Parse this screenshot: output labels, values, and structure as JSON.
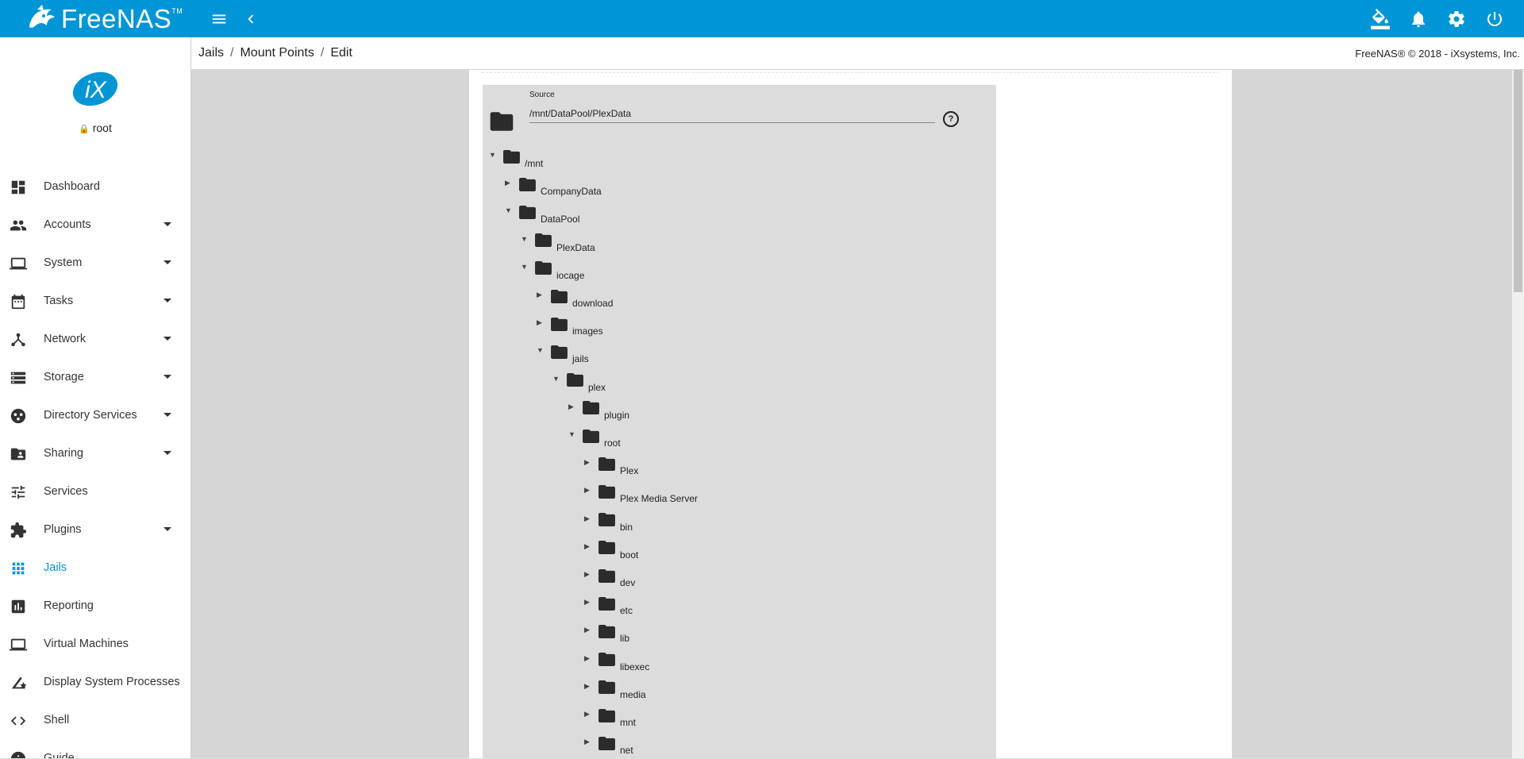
{
  "app": {
    "name": "FreeNAS",
    "trademark": "TM"
  },
  "topbar": {
    "icons": [
      "menu-icon",
      "chevron-left-icon",
      "paint-bucket-icon",
      "bell-icon",
      "gear-icon",
      "power-icon"
    ]
  },
  "user": {
    "name": "root"
  },
  "sidebar": {
    "items": [
      {
        "label": "Dashboard",
        "icon": "dashboard-icon",
        "has_children": false,
        "active": false
      },
      {
        "label": "Accounts",
        "icon": "people-icon",
        "has_children": true,
        "active": false
      },
      {
        "label": "System",
        "icon": "laptop-icon",
        "has_children": true,
        "active": false
      },
      {
        "label": "Tasks",
        "icon": "calendar-icon",
        "has_children": true,
        "active": false
      },
      {
        "label": "Network",
        "icon": "network-icon",
        "has_children": true,
        "active": false
      },
      {
        "label": "Storage",
        "icon": "storage-icon",
        "has_children": true,
        "active": false
      },
      {
        "label": "Directory Services",
        "icon": "directory-icon",
        "has_children": true,
        "active": false
      },
      {
        "label": "Sharing",
        "icon": "share-folder-icon",
        "has_children": true,
        "active": false
      },
      {
        "label": "Services",
        "icon": "tune-icon",
        "has_children": false,
        "active": false
      },
      {
        "label": "Plugins",
        "icon": "puzzle-icon",
        "has_children": true,
        "active": false
      },
      {
        "label": "Jails",
        "icon": "apps-grid-icon",
        "has_children": false,
        "active": true
      },
      {
        "label": "Reporting",
        "icon": "bar-chart-icon",
        "has_children": false,
        "active": false
      },
      {
        "label": "Virtual Machines",
        "icon": "laptop-icon",
        "has_children": false,
        "active": false
      },
      {
        "label": "Display System Processes",
        "icon": "processes-icon",
        "has_children": false,
        "active": false
      },
      {
        "label": "Shell",
        "icon": "code-icon",
        "has_children": false,
        "active": false
      },
      {
        "label": "Guide",
        "icon": "info-icon",
        "has_children": false,
        "active": false
      }
    ]
  },
  "breadcrumb": {
    "items": [
      "Jails",
      "Mount Points",
      "Edit"
    ],
    "separator": "/"
  },
  "copyright": "FreeNAS® © 2018 - iXsystems, Inc.",
  "form": {
    "source_label": "Source",
    "source_value": "/mnt/DataPool/PlexData",
    "help_glyph": "?"
  },
  "tree": [
    {
      "name": "/mnt",
      "depth": 0,
      "expanded": true
    },
    {
      "name": "CompanyData",
      "depth": 1,
      "expanded": false
    },
    {
      "name": "DataPool",
      "depth": 1,
      "expanded": true
    },
    {
      "name": "PlexData",
      "depth": 2,
      "expanded": true
    },
    {
      "name": "iocage",
      "depth": 2,
      "expanded": true
    },
    {
      "name": "download",
      "depth": 3,
      "expanded": false
    },
    {
      "name": "images",
      "depth": 3,
      "expanded": false
    },
    {
      "name": "jails",
      "depth": 3,
      "expanded": true
    },
    {
      "name": "plex",
      "depth": 4,
      "expanded": true
    },
    {
      "name": "plugin",
      "depth": 5,
      "expanded": false
    },
    {
      "name": "root",
      "depth": 5,
      "expanded": true
    },
    {
      "name": "Plex",
      "depth": 6,
      "expanded": false
    },
    {
      "name": "Plex Media Server",
      "depth": 6,
      "expanded": false
    },
    {
      "name": "bin",
      "depth": 6,
      "expanded": false
    },
    {
      "name": "boot",
      "depth": 6,
      "expanded": false
    },
    {
      "name": "dev",
      "depth": 6,
      "expanded": false
    },
    {
      "name": "etc",
      "depth": 6,
      "expanded": false
    },
    {
      "name": "lib",
      "depth": 6,
      "expanded": false
    },
    {
      "name": "libexec",
      "depth": 6,
      "expanded": false
    },
    {
      "name": "media",
      "depth": 6,
      "expanded": false
    },
    {
      "name": "mnt",
      "depth": 6,
      "expanded": false
    },
    {
      "name": "net",
      "depth": 6,
      "expanded": false
    }
  ],
  "colors": {
    "brand": "#0095d5",
    "active_nav": "#0095d5",
    "panel": "#dcdcdc"
  }
}
